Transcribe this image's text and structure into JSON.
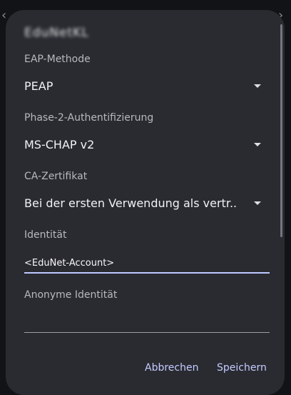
{
  "background": {
    "left_arrow_icon": "back-arrow-icon",
    "right_arrow_icon": "back-arrow-icon"
  },
  "dialog": {
    "network_name": "EduNetKL",
    "fields": {
      "eap_method": {
        "label": "EAP-Methode",
        "value": "PEAP",
        "icon": "dropdown-caret-icon"
      },
      "phase2_auth": {
        "label": "Phase-2-Authentifizierung",
        "value": "MS-CHAP v2",
        "icon": "dropdown-caret-icon"
      },
      "ca_certificate": {
        "label": "CA-Zertifikat",
        "value": "Bei der ersten Verwendung als vertr..",
        "icon": "dropdown-caret-icon"
      },
      "identity": {
        "label": "Identität",
        "value": "<EduNet-Account>"
      },
      "anonymous_identity": {
        "label": "Anonyme Identität",
        "value": ""
      }
    },
    "actions": {
      "cancel_label": "Abbrechen",
      "save_label": "Speichern"
    }
  },
  "colors": {
    "dialog_background": "#2a2b31",
    "accent": "#c4cbff",
    "focused_underline": "#bfc9ff",
    "text_primary": "#f1f2f4",
    "text_secondary": "#b7b9be"
  }
}
